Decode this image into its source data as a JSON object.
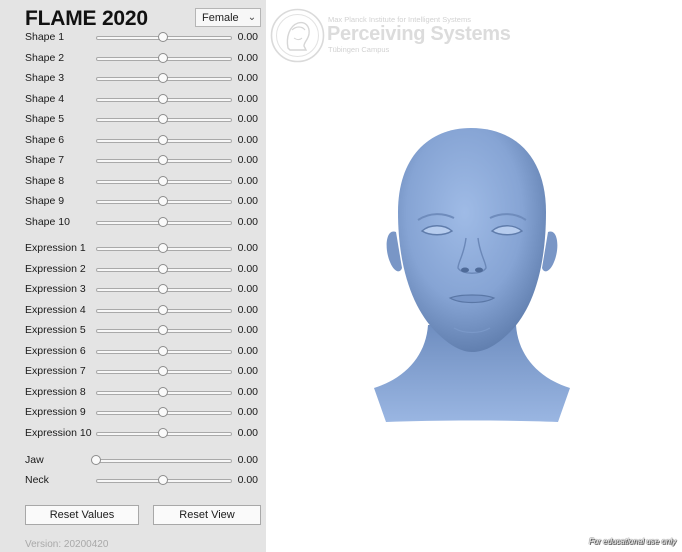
{
  "app": {
    "title": "FLAME 2020",
    "gender_select": {
      "value": "Female"
    },
    "version": "Version: 20200420"
  },
  "sliders": [
    {
      "label": "Shape 1",
      "value": "0.00",
      "level": 0.5
    },
    {
      "label": "Shape 2",
      "value": "0.00",
      "level": 0.5
    },
    {
      "label": "Shape 3",
      "value": "0.00",
      "level": 0.5
    },
    {
      "label": "Shape 4",
      "value": "0.00",
      "level": 0.5
    },
    {
      "label": "Shape 5",
      "value": "0.00",
      "level": 0.5
    },
    {
      "label": "Shape 6",
      "value": "0.00",
      "level": 0.5
    },
    {
      "label": "Shape 7",
      "value": "0.00",
      "level": 0.5
    },
    {
      "label": "Shape 8",
      "value": "0.00",
      "level": 0.5
    },
    {
      "label": "Shape 9",
      "value": "0.00",
      "level": 0.5
    },
    {
      "label": "Shape 10",
      "value": "0.00",
      "level": 0.5
    },
    {
      "label": "Expression 1",
      "value": "0.00",
      "level": 0.5
    },
    {
      "label": "Expression 2",
      "value": "0.00",
      "level": 0.5
    },
    {
      "label": "Expression 3",
      "value": "0.00",
      "level": 0.5
    },
    {
      "label": "Expression 4",
      "value": "0.00",
      "level": 0.5
    },
    {
      "label": "Expression 5",
      "value": "0.00",
      "level": 0.5
    },
    {
      "label": "Expression 6",
      "value": "0.00",
      "level": 0.5
    },
    {
      "label": "Expression 7",
      "value": "0.00",
      "level": 0.5
    },
    {
      "label": "Expression 8",
      "value": "0.00",
      "level": 0.5
    },
    {
      "label": "Expression 9",
      "value": "0.00",
      "level": 0.5
    },
    {
      "label": "Expression 10",
      "value": "0.00",
      "level": 0.5
    },
    {
      "label": "Jaw",
      "value": "0.00",
      "level": 0.0
    },
    {
      "label": "Neck",
      "value": "0.00",
      "level": 0.5
    }
  ],
  "buttons": {
    "reset_values": "Reset Values",
    "reset_view": "Reset View"
  },
  "branding": {
    "institute": "Max Planck Institute for Intelligent Systems",
    "name": "Perceiving Systems",
    "city": "Tübingen Campus",
    "logo_icon": "minerva-logo-icon"
  },
  "viewport": {
    "model_icon": "3d-head-model-icon",
    "model_color": "#86a4d4",
    "notice": "For educational use only"
  },
  "colors": {
    "panel_bg": "#e4e4e4",
    "viewport_bg": "#ffffff"
  }
}
